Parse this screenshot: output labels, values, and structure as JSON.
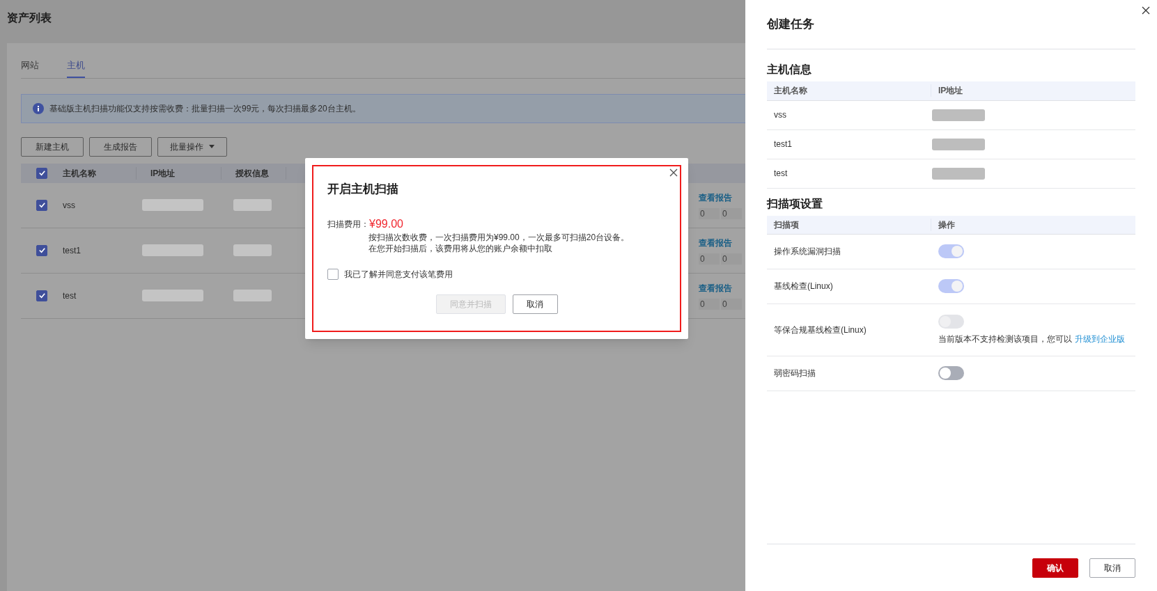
{
  "page": {
    "title": "资产列表",
    "tabs": [
      {
        "label": "网站",
        "selected": false
      },
      {
        "label": "主机",
        "selected": true
      }
    ],
    "info_banner": "基础版主机扫描功能仅支持按需收费：批量扫描一次99元，每次扫描最多20台主机。",
    "toolbar": [
      {
        "label": "新建主机",
        "kind": "plain"
      },
      {
        "label": "生成报告",
        "kind": "plain"
      },
      {
        "label": "批量操作",
        "kind": "dropdown"
      }
    ],
    "table": {
      "all_checked": true,
      "columns": [
        "主机名称",
        "IP地址",
        "授权信息"
      ],
      "rows": [
        {
          "name": "vss",
          "checked": true,
          "link": "查看报告",
          "counts": [
            "0",
            "0"
          ]
        },
        {
          "name": "test1",
          "checked": true,
          "link": "查看报告",
          "counts": [
            "0",
            "0"
          ]
        },
        {
          "name": "test",
          "checked": true,
          "link": "查看报告",
          "counts": [
            "0",
            "0"
          ]
        }
      ]
    }
  },
  "modal": {
    "title": "开启主机扫描",
    "fee_label": "扫描费用：",
    "fee_amount": "¥99.00",
    "notes": [
      "按扫描次数收费，一次扫描费用为¥99.00，一次最多可扫描20台设备。",
      "在您开始扫描后，该费用将从您的账户余额中扣取"
    ],
    "agree": {
      "label": "我已了解并同意支付该笔费用",
      "checked": false
    },
    "buttons": [
      {
        "label": "同意并扫描",
        "disabled": true
      },
      {
        "label": "取消",
        "disabled": false
      }
    ]
  },
  "drawer": {
    "title": "创建任务",
    "hosts": {
      "heading": "主机信息",
      "columns": [
        "主机名称",
        "IP地址"
      ],
      "rows": [
        {
          "name": "vss"
        },
        {
          "name": "test1"
        },
        {
          "name": "test"
        }
      ]
    },
    "scan": {
      "heading": "扫描项设置",
      "columns": [
        "扫描项",
        "操作"
      ],
      "items": [
        {
          "label": "操作系统漏洞扫描",
          "on": true,
          "disabled": false
        },
        {
          "label": "基线检查(Linux)",
          "on": true,
          "disabled": false
        },
        {
          "label": "等保合规基线检查(Linux)",
          "on": false,
          "disabled": true,
          "note": "当前版本不支持检测该项目，您可以",
          "link": "升级到企业版"
        },
        {
          "label": "弱密码扫描",
          "on": false,
          "disabled": false
        }
      ]
    },
    "buttons": [
      {
        "label": "确认",
        "kind": "primary"
      },
      {
        "label": "取消",
        "kind": "default"
      }
    ]
  }
}
